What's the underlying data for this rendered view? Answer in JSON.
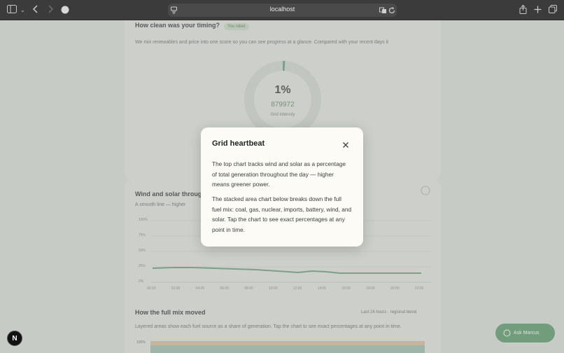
{
  "browser": {
    "url": "localhost"
  },
  "page": {
    "timing": {
      "title": "How clean was your timing?",
      "badge": "You rated",
      "description": "We mix renewables and price into one score so you can see progress at a glance. Compared with your recent days it",
      "donut_value": "1%",
      "donut_sub": "879972",
      "donut_caption": "Grid intensity"
    },
    "wind_solar": {
      "title": "Wind and solar throughout",
      "subtitle": "A smooth line — higher",
      "right_note": "",
      "y_ticks": [
        "100%",
        "75%",
        "50%",
        "25%",
        "0%"
      ],
      "x_ticks": [
        "00:00",
        "02:00",
        "04:00",
        "06:00",
        "08:00",
        "10:00",
        "12:00",
        "14:00",
        "16:00",
        "18:00",
        "20:00",
        "22:00"
      ]
    },
    "full_mix": {
      "title": "How the full mix moved",
      "right_note": "Last 24 hours · regional blend",
      "subtitle": "Layered areas show each fuel source as a share of generation. Tap the chart to see exact percentages at any point in time.",
      "y_tick": "100%"
    }
  },
  "modal": {
    "title": "Grid heartbeat",
    "paragraph_1": "The top chart tracks wind and solar as a percentage of total generation throughout the day — higher means greener power.",
    "paragraph_2": "The stacked area chart below breaks down the full fuel mix: coal, gas, nuclear, imports, battery, wind, and solar. Tap the chart to see exact percentages at any point in time."
  },
  "badge_n": "N",
  "fab_label": "Ask Marcus",
  "colors": {
    "accent": "#4f8a5e",
    "line": "#6aa07a"
  }
}
